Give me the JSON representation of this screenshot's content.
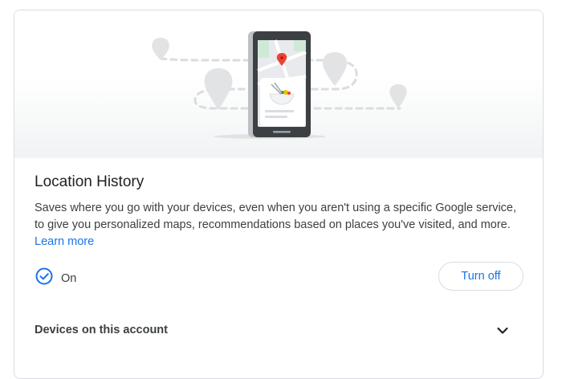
{
  "card": {
    "title": "Location History",
    "description": "Saves where you go with your devices, even when you aren't using a specific Google service, to give you personalized maps, recommendations based on places you've visited, and more.",
    "learn_more": "Learn more",
    "status": {
      "icon": "check-circle-icon",
      "label": "On"
    },
    "turn_off_button": "Turn off",
    "devices": {
      "label": "Devices on this account",
      "icon": "chevron-down-icon"
    }
  },
  "colors": {
    "accent": "#1a73e8",
    "text": "#202124",
    "secondary_text": "#3c4043",
    "border": "#dadce0",
    "pin_red": "#ea4335"
  }
}
